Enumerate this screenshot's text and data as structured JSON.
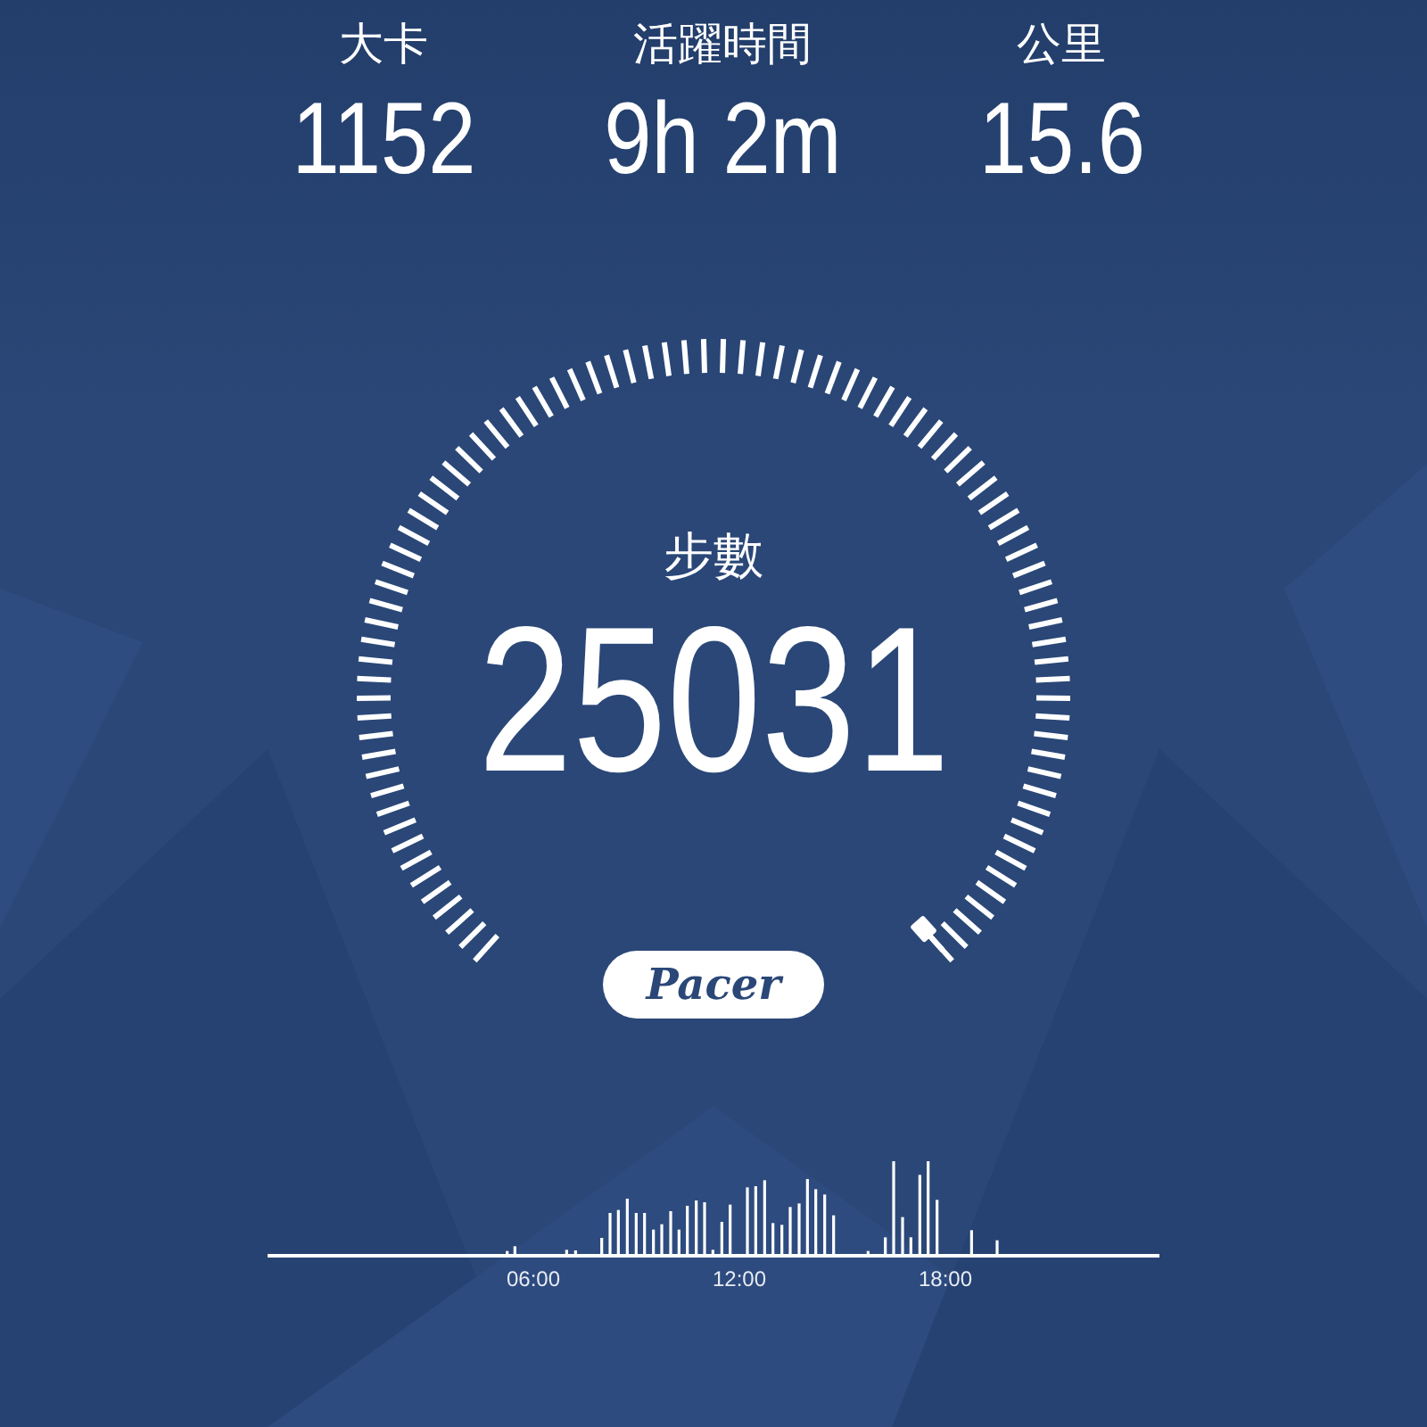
{
  "stats": [
    {
      "label": "大卡",
      "value": "1152"
    },
    {
      "label": "活躍時間",
      "value": "9h 2m"
    },
    {
      "label": "公里",
      "value": "15.6"
    }
  ],
  "steps": {
    "label": "步數",
    "value": "25031"
  },
  "logo": {
    "text": "Pacer"
  },
  "activity_chart": {
    "axis_labels": [
      "06:00",
      "12:00",
      "18:00"
    ]
  }
}
